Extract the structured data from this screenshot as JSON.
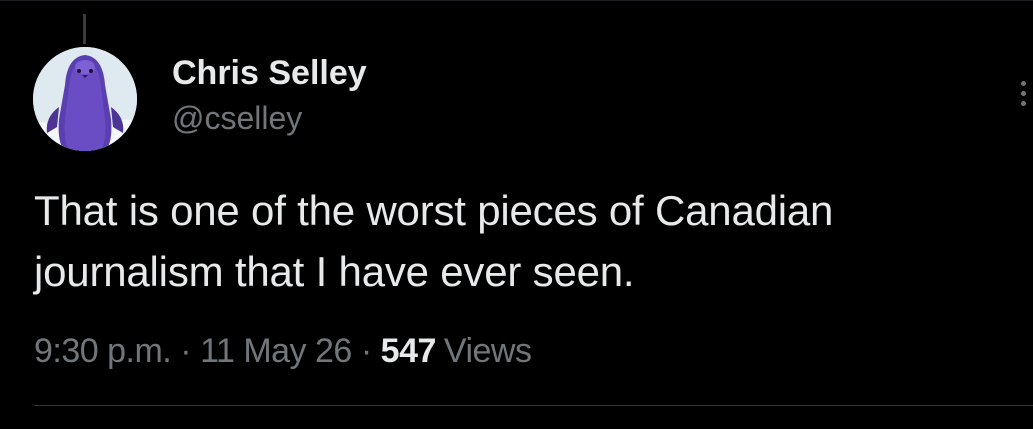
{
  "tweet": {
    "author": {
      "display_name": "Chris Selley",
      "handle": "@cselley",
      "avatar_icon": "purple-penguin-avatar"
    },
    "text_lines": [
      "That is one of the worst pieces of Canadian",
      "journalism that I have ever seen."
    ],
    "meta": {
      "time": "9:30 p.m.",
      "separator": "·",
      "date": "11 May 26",
      "views_count": "547",
      "views_label": "Views"
    },
    "more_icon": "more-vertical-icon"
  },
  "colors": {
    "background": "#000000",
    "primary_text": "#e7e9ea",
    "secondary_text": "#71767b",
    "divider": "#2f3336"
  }
}
